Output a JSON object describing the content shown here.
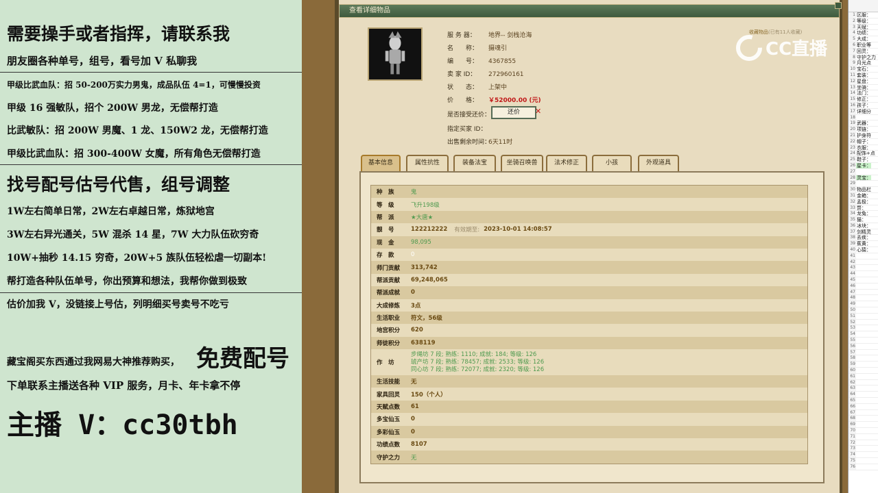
{
  "left_panel": {
    "lines": [
      "需要操手或者指挥，请联系我",
      "朋友圈各种单号，组号，看号加 V 私聊我",
      "甲级比武血队：招 50-200万实力男鬼，成品队伍 4=1，可慢慢投资",
      "甲级 16 强敏队，招个 200W 男龙，无偿帮打造",
      "比武敏队：招 200W 男魔、1 龙、150W2 龙，无偿帮打造",
      "甲级比武血队：招 300-400W 女魔，所有角色无偿帮打造",
      "找号配号估号代售，组号调整",
      "1W左右简单日常，2W左右卓越日常，炼狱地宫",
      "3W左右异光通关，5W 混杀 14 星，7W 大力队伍砍穷奇",
      "10W+抽秒 14.15 穷奇，20W+5 族队伍轻松虐一切副本!",
      "帮打造各种队伍单号，你出预算和想法，我帮你做到极致",
      "估价加我 V，没链接上号估，列明细买号卖号不吃亏",
      "藏宝阁买东西通过我网易大神推荐购买，",
      "免费配号",
      "下单联系主播送各种 VIP 服务，月卡、年卡拿不停",
      "主播 V：cc30tbh"
    ]
  },
  "window": {
    "title": "查看详细物品"
  },
  "item": {
    "server_label": "服 务 器：",
    "server_value": "地界-- 剑栈沧海",
    "name_label": "名　　称：",
    "name_value": "摄魂引",
    "id_label": "编　　号：",
    "id_value": "4367855",
    "seller_label": "卖 家 ID：",
    "seller_value": "272960161",
    "status_label": "状　　态：",
    "status_value": "上架中",
    "price_label": "价　　格：",
    "price_value": "￥52000.00 (元)",
    "counter_label": "是否接受还价：",
    "counter_button": "还价",
    "buyer_label": "指定买家 ID：",
    "time_label": "出售剩余时间：",
    "time_value": "6天11时",
    "fav_link": "收藏物品",
    "fav_count": "(已有11人收藏)"
  },
  "tabs": [
    {
      "label": "基本信息",
      "active": true
    },
    {
      "label": "属性抗性",
      "active": false
    },
    {
      "label": "装备法宝",
      "active": false
    },
    {
      "label": "坐骑召唤兽",
      "active": false
    },
    {
      "label": "法术修正",
      "active": false
    },
    {
      "label": "小孩",
      "active": false
    },
    {
      "label": "外观道具",
      "active": false
    }
  ],
  "details": {
    "race_k": "种　族",
    "race_v": "鬼",
    "level_k": "等　级",
    "level_v": "飞升198级",
    "faction_k": "帮　派",
    "faction_v": "★大唐★",
    "acct_k": "靓　号",
    "acct_v": "122212222",
    "acct_expire_k": "有效期至:",
    "acct_expire_v": "2023-10-01 14:08:57",
    "cash_k": "现　金",
    "cash_v": "98,095",
    "deposit_k": "存　款",
    "deposit_v": "0",
    "sect_k": "师门贡献",
    "sect_v": "313,742",
    "guild_k": "帮派贡献",
    "guild_v": "69,248,065",
    "guildach_k": "帮派成就",
    "guildach_v": "0",
    "cult_k": "大成修炼",
    "cult_v": "3点",
    "job_k": "生活职业",
    "job_v": "符文，56级",
    "merit_k": "地宫积分",
    "merit_v": "620",
    "evil_k": "师徒积分",
    "evil_v": "638119",
    "work_k": "作　坊",
    "work_1": "步绳坊 7 段; 熟练: 1110; 成就: 184; 等级: 126",
    "work_2": "琥产坊 7 段; 熟练: 78457; 成就: 2533; 等级: 126",
    "work_3": "同心坊 7 段; 熟练: 72077; 成就: 2320; 等级: 126",
    "skill_k": "生活技能",
    "skill_v": "无",
    "home_k": "家具回灵",
    "home_v": "150（个人）",
    "talent_k": "天赋点数",
    "talent_v": "61",
    "jade1_k": "多宝仙玉",
    "jade1_v": "0",
    "jade2_k": "多彩仙玉",
    "jade2_v": "0",
    "feat_k": "功绩点数",
    "feat_v": "8107",
    "guard_k": "守护之力",
    "guard_v": "无"
  },
  "watermark": "CC直播",
  "sheet": {
    "rows": [
      {
        "n": "1",
        "t": "区服："
      },
      {
        "n": "2",
        "t": "等级："
      },
      {
        "n": "3",
        "t": "天赋："
      },
      {
        "n": "4",
        "t": "功绩："
      },
      {
        "n": "5",
        "t": "大成："
      },
      {
        "n": "6",
        "t": "职业等"
      },
      {
        "n": "7",
        "t": "回灵："
      },
      {
        "n": "8",
        "t": "守护之力"
      },
      {
        "n": "9",
        "t": "月光点"
      },
      {
        "n": "10",
        "t": "宝石："
      },
      {
        "n": "11",
        "t": "套装："
      },
      {
        "n": "12",
        "t": "星盘："
      },
      {
        "n": "13",
        "t": "坐骑："
      },
      {
        "n": "14",
        "t": "法门："
      },
      {
        "n": "15",
        "t": "修正："
      },
      {
        "n": "16",
        "t": "孩子："
      },
      {
        "n": "17",
        "t": "详细分"
      },
      {
        "n": "18",
        "t": ""
      },
      {
        "n": "19",
        "t": "武器："
      },
      {
        "n": "20",
        "t": "项链："
      },
      {
        "n": "21",
        "t": "护身符"
      },
      {
        "n": "22",
        "t": "帽子："
      },
      {
        "n": "23",
        "t": "衣服："
      },
      {
        "n": "24",
        "t": "配饰+点"
      },
      {
        "n": "25",
        "t": "鞋子："
      },
      {
        "n": "26",
        "t": "星卡："
      },
      {
        "n": "27",
        "t": ""
      },
      {
        "n": "28",
        "t": "灵宝："
      },
      {
        "n": "29",
        "t": ""
      },
      {
        "n": "30",
        "t": "物品栏"
      },
      {
        "n": "31",
        "t": "金箱："
      },
      {
        "n": "32",
        "t": "孟极："
      },
      {
        "n": "33",
        "t": "赘："
      },
      {
        "n": "34",
        "t": "龙兔："
      },
      {
        "n": "35",
        "t": "猫："
      },
      {
        "n": "36",
        "t": "冰块："
      },
      {
        "n": "37",
        "t": "剑精灵"
      },
      {
        "n": "38",
        "t": "去疾："
      },
      {
        "n": "39",
        "t": "蕉黄："
      },
      {
        "n": "40",
        "t": "心猿："
      },
      {
        "n": "41",
        "t": ""
      },
      {
        "n": "42",
        "t": ""
      },
      {
        "n": "43",
        "t": ""
      },
      {
        "n": "44",
        "t": ""
      },
      {
        "n": "45",
        "t": ""
      },
      {
        "n": "46",
        "t": ""
      },
      {
        "n": "47",
        "t": ""
      },
      {
        "n": "48",
        "t": ""
      },
      {
        "n": "49",
        "t": ""
      },
      {
        "n": "50",
        "t": ""
      },
      {
        "n": "51",
        "t": ""
      },
      {
        "n": "52",
        "t": ""
      },
      {
        "n": "53",
        "t": ""
      },
      {
        "n": "54",
        "t": ""
      },
      {
        "n": "55",
        "t": ""
      },
      {
        "n": "56",
        "t": ""
      },
      {
        "n": "57",
        "t": ""
      },
      {
        "n": "58",
        "t": ""
      },
      {
        "n": "59",
        "t": ""
      },
      {
        "n": "60",
        "t": ""
      },
      {
        "n": "61",
        "t": ""
      },
      {
        "n": "62",
        "t": ""
      },
      {
        "n": "63",
        "t": ""
      },
      {
        "n": "64",
        "t": ""
      },
      {
        "n": "65",
        "t": ""
      },
      {
        "n": "66",
        "t": ""
      },
      {
        "n": "67",
        "t": ""
      },
      {
        "n": "68",
        "t": ""
      },
      {
        "n": "69",
        "t": ""
      },
      {
        "n": "70",
        "t": ""
      },
      {
        "n": "71",
        "t": ""
      },
      {
        "n": "72",
        "t": ""
      },
      {
        "n": "73",
        "t": ""
      },
      {
        "n": "74",
        "t": ""
      },
      {
        "n": "75",
        "t": ""
      },
      {
        "n": "76",
        "t": ""
      }
    ]
  }
}
